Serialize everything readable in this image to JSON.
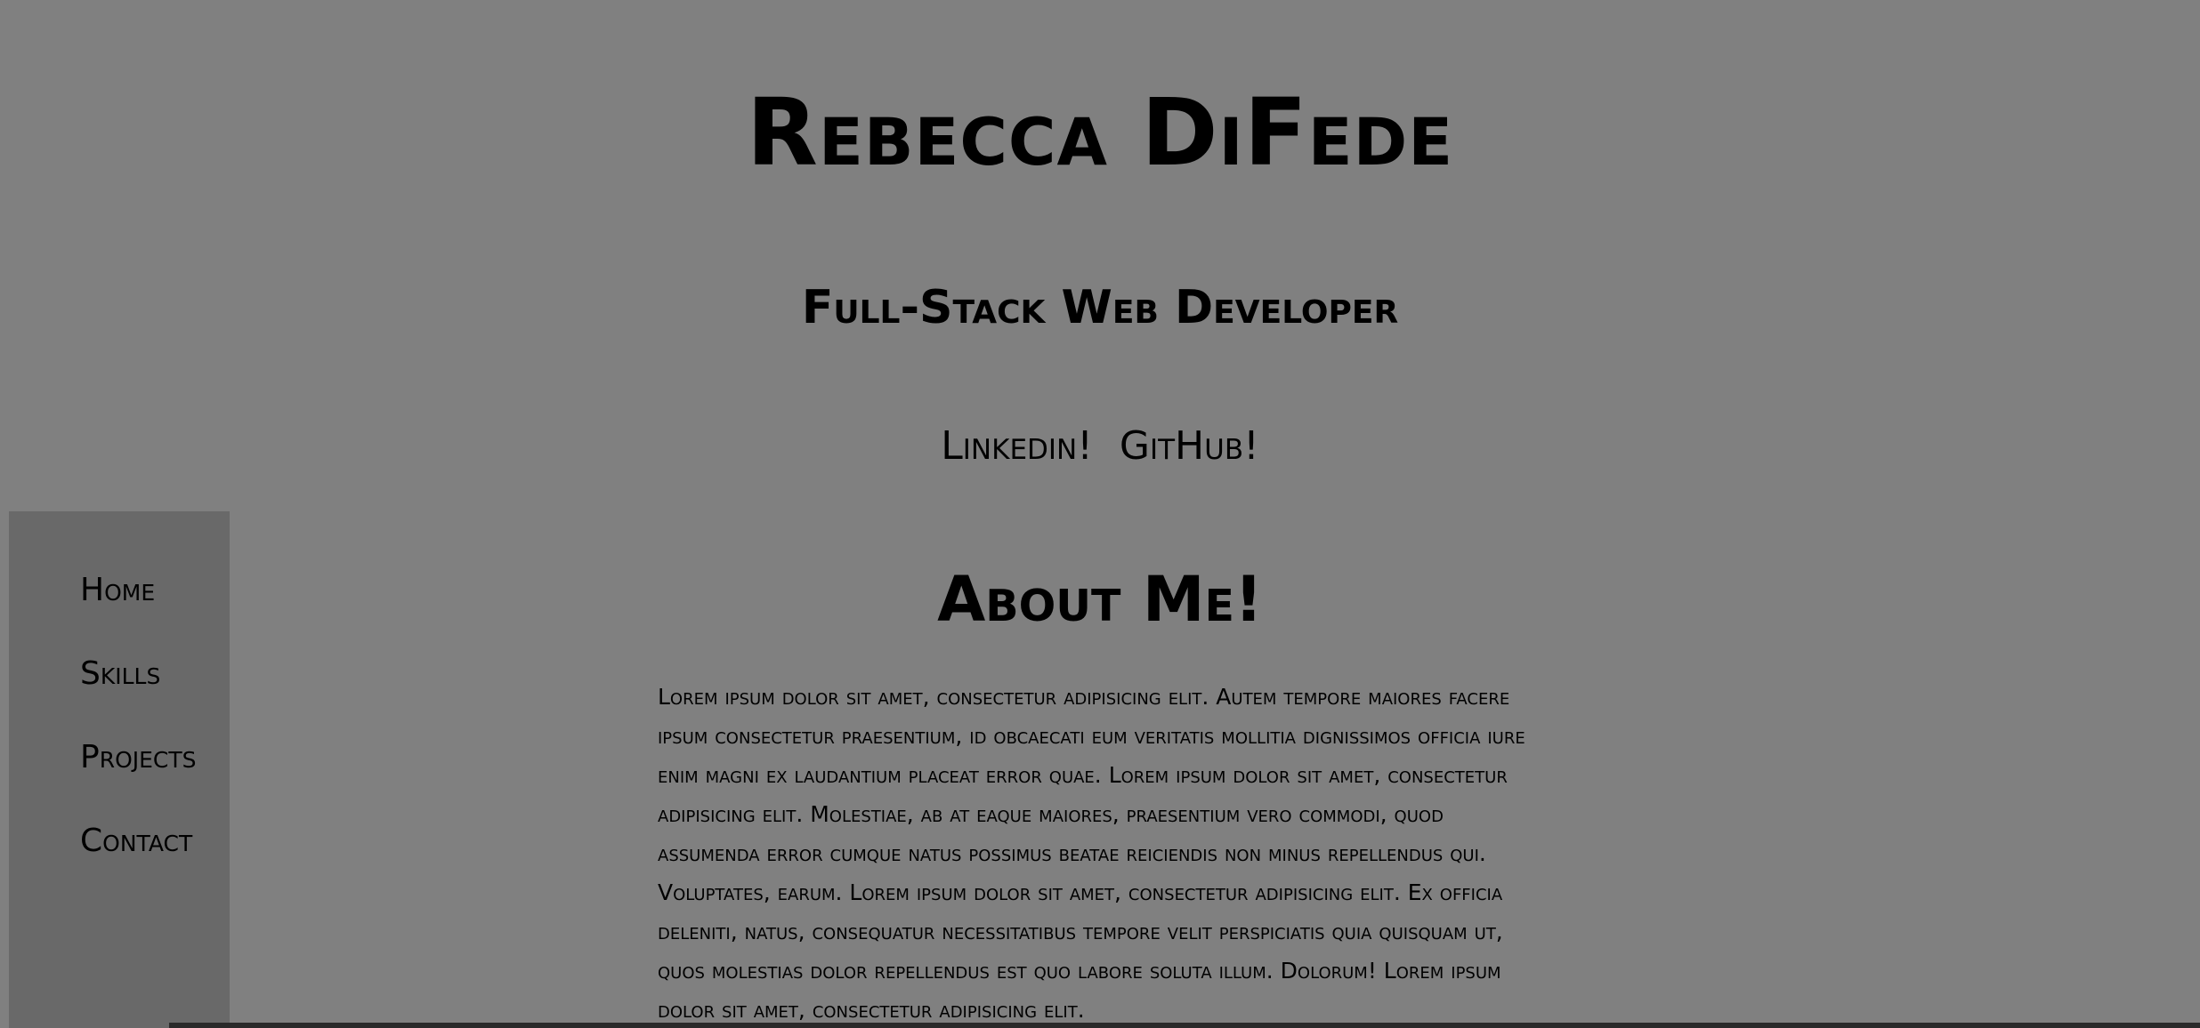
{
  "header": {
    "name": "Rebecca DiFede",
    "subtitle": "Full-Stack Web Developer"
  },
  "social": {
    "links": [
      {
        "label": "Linkedin!"
      },
      {
        "label": "GitHub!"
      }
    ]
  },
  "sidebar": {
    "items": [
      {
        "label": "Home"
      },
      {
        "label": "Skills"
      },
      {
        "label": "Projects"
      },
      {
        "label": "Contact"
      }
    ]
  },
  "about": {
    "heading": "About Me!",
    "body": "Lorem ipsum dolor sit amet, consectetur adipisicing elit. Autem tempore maiores facere ipsum consectetur praesentium, id obcaecati eum veritatis mollitia dignissimos officia iure enim magni ex laudantium placeat error quae. Lorem ipsum dolor sit amet, consectetur adipisicing elit. Molestiae, ab at eaque maiores, praesentium vero commodi, quod assumenda error cumque natus possimus beatae reiciendis non minus repellendus qui. Voluptates, earum. Lorem ipsum dolor sit amet, consectetur adipisicing elit. Ex officia deleniti, natus, consequatur necessitatibus tempore velit perspiciatis quia quisquam ut, quos molestias dolor repellendus est quo labore soluta illum. Dolorum! Lorem ipsum dolor sit amet, consectetur adipisicing elit."
  },
  "colors": {
    "page_background": "#808080",
    "sidebar_background": "#696969",
    "text": "#000000"
  }
}
